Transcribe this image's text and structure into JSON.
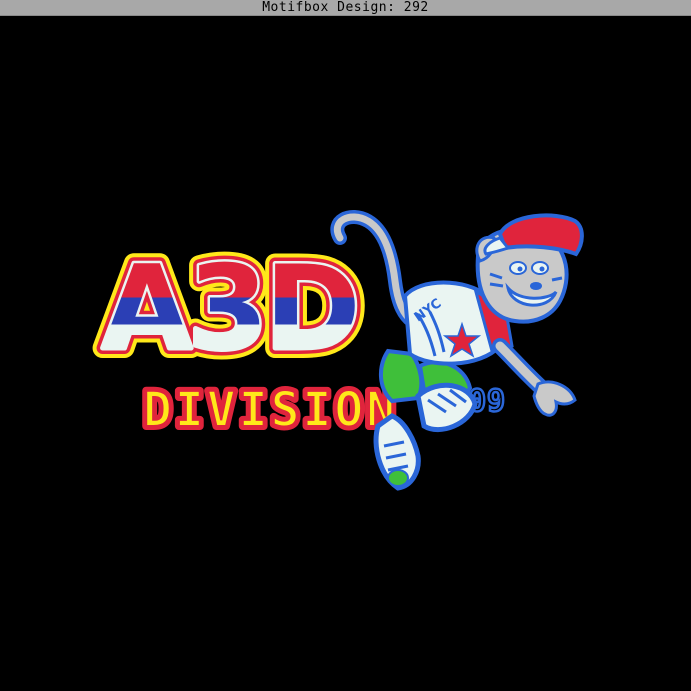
{
  "window": {
    "title": "Motifbox Design: 292"
  },
  "design": {
    "logo_main_text": "A3D",
    "logo_sub_text": "DIVISION",
    "badge_text": "09",
    "shirt_text": "NYC",
    "colors": {
      "background": "#000000",
      "red": "#e0243c",
      "blue": "#2b3fb5",
      "yellow": "#ffe81a",
      "pale": "#eaf5f2",
      "tiger_blue": "#2a66d8",
      "tiger_gray": "#c9c9c9",
      "green": "#3fbf3a"
    }
  }
}
